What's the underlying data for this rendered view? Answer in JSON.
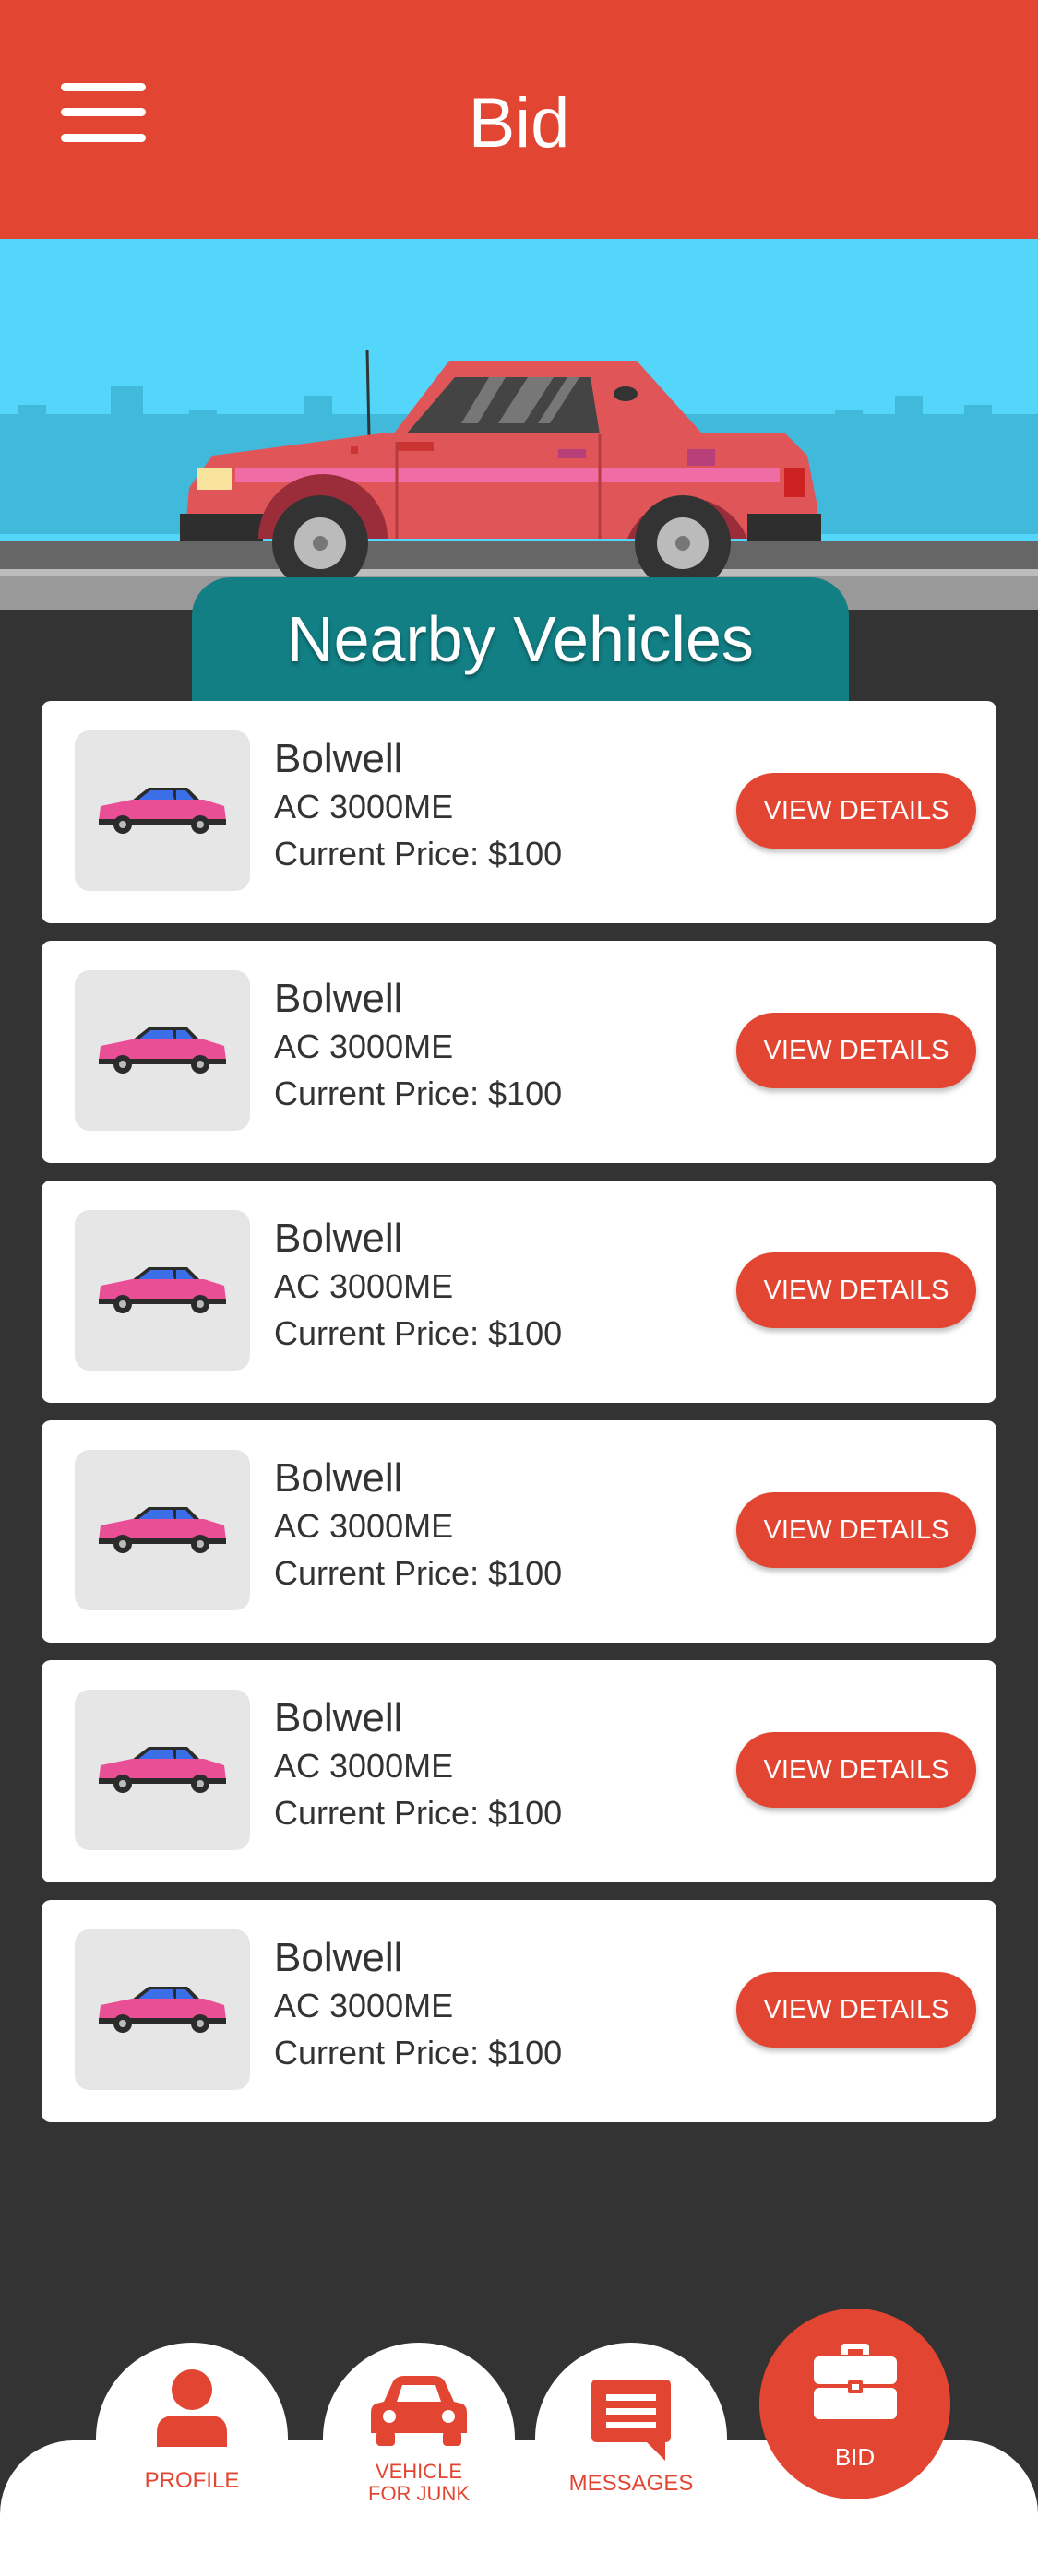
{
  "header": {
    "title": "Bid",
    "menu_icon": "hamburger-menu-icon"
  },
  "hero": {
    "heading": "Nearby Vehicles"
  },
  "vehicles": [
    {
      "make": "Bolwell",
      "model": "AC 3000ME",
      "price": "Current Price: $100",
      "button": "VIEW DETAILS"
    },
    {
      "make": "Bolwell",
      "model": "AC 3000ME",
      "price": "Current Price: $100",
      "button": "VIEW DETAILS"
    },
    {
      "make": "Bolwell",
      "model": "AC 3000ME",
      "price": "Current Price: $100",
      "button": "VIEW DETAILS"
    },
    {
      "make": "Bolwell",
      "model": "AC 3000ME",
      "price": "Current Price: $100",
      "button": "VIEW DETAILS"
    },
    {
      "make": "Bolwell",
      "model": "AC 3000ME",
      "price": "Current Price: $100",
      "button": "VIEW DETAILS"
    },
    {
      "make": "Bolwell",
      "model": "AC 3000ME",
      "price": "Current Price: $100",
      "button": "VIEW DETAILS"
    }
  ],
  "bottom_nav": {
    "profile": {
      "label": "PROFILE",
      "icon": "person-icon"
    },
    "vehicle": {
      "label_line1": "VEHICLE",
      "label_line2": "FOR JUNK",
      "icon": "car-icon"
    },
    "messages": {
      "label": "MESSAGES",
      "icon": "chat-icon"
    },
    "bid": {
      "label": "BID",
      "icon": "briefcase-icon"
    }
  },
  "colors": {
    "accent": "#e24632",
    "teal": "#117f84",
    "background": "#333333",
    "sky": "#54d6fb"
  }
}
